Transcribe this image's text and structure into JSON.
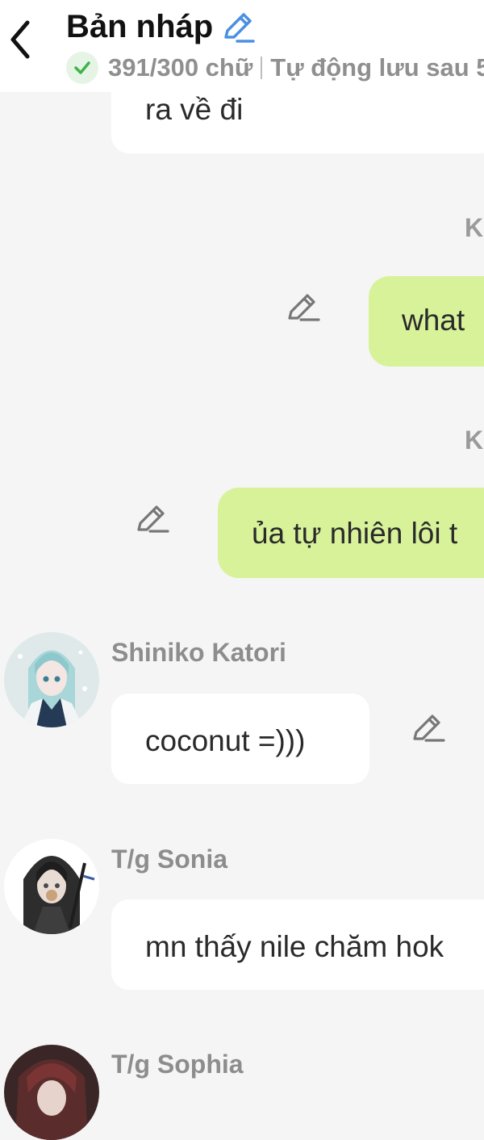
{
  "header": {
    "title": "Bản nháp",
    "char_count": "391/300 chữ",
    "autosave": "Tự động lưu sau 5",
    "accent_color": "#4a90e2",
    "check_color": "#3cb44b"
  },
  "messages": [
    {
      "type": "white-bubble",
      "text": "ra về đi"
    },
    {
      "type": "sender-tag",
      "text": "K"
    },
    {
      "type": "green-bubble",
      "text": "what"
    },
    {
      "type": "sender-tag",
      "text": "K"
    },
    {
      "type": "green-bubble",
      "text": "ủa tự nhiên lôi t"
    },
    {
      "type": "incoming",
      "sender": "Shiniko Katori",
      "text": "coconut =)))"
    },
    {
      "type": "incoming",
      "sender": "T/g Sonia",
      "text": "mn thấy nile chăm hok"
    },
    {
      "type": "incoming",
      "sender": "T/g Sophia",
      "text": ""
    }
  ],
  "colors": {
    "background": "#f5f5f5",
    "bubble_white": "#ffffff",
    "bubble_green": "#d8f29a"
  },
  "icons": {
    "back": "chevron-left-icon",
    "title_edit": "pencil-icon",
    "status": "check-icon",
    "message_edit": "pencil-icon"
  }
}
